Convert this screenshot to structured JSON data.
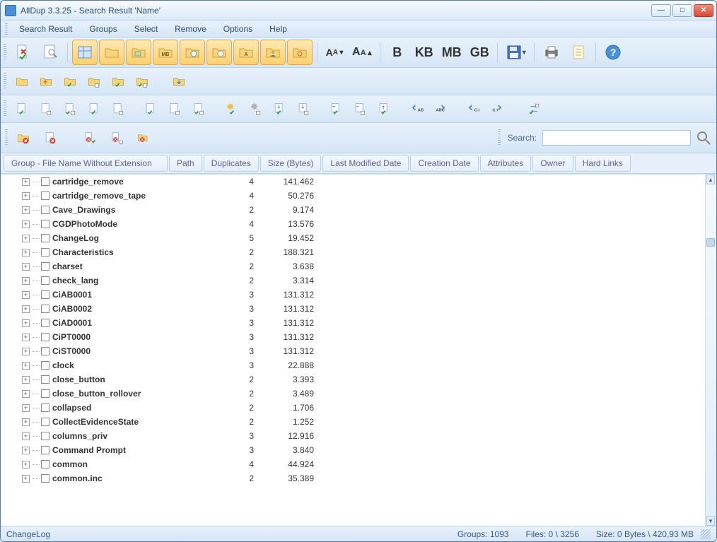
{
  "title": "AllDup 3.3.25 - Search Result 'Name'",
  "menus": [
    "Search Result",
    "Groups",
    "Select",
    "Remove",
    "Options",
    "Help"
  ],
  "font_buttons": {
    "dec": "A̲A ▾",
    "inc": "A̅A ▴"
  },
  "unit_buttons": [
    "B",
    "KB",
    "MB",
    "GB"
  ],
  "search_label": "Search:",
  "search_value": "",
  "columns": [
    "Group - File Name Without Extension",
    "Path",
    "Duplicates",
    "Size (Bytes)",
    "Last Modified Date",
    "Creation Date",
    "Attributes",
    "Owner",
    "Hard Links"
  ],
  "rows": [
    {
      "name": "cartridge_remove",
      "dup": "4",
      "size": "141.462"
    },
    {
      "name": "cartridge_remove_tape",
      "dup": "4",
      "size": "50.276"
    },
    {
      "name": "Cave_Drawings",
      "dup": "2",
      "size": "9.174"
    },
    {
      "name": "CGDPhotoMode",
      "dup": "4",
      "size": "13.576"
    },
    {
      "name": "ChangeLog",
      "dup": "5",
      "size": "19.452"
    },
    {
      "name": "Characteristics",
      "dup": "2",
      "size": "188.321"
    },
    {
      "name": "charset",
      "dup": "2",
      "size": "3.638"
    },
    {
      "name": "check_lang",
      "dup": "2",
      "size": "3.314"
    },
    {
      "name": "CiAB0001",
      "dup": "3",
      "size": "131.312"
    },
    {
      "name": "CiAB0002",
      "dup": "3",
      "size": "131.312"
    },
    {
      "name": "CiAD0001",
      "dup": "3",
      "size": "131.312"
    },
    {
      "name": "CiPT0000",
      "dup": "3",
      "size": "131.312"
    },
    {
      "name": "CiST0000",
      "dup": "3",
      "size": "131.312"
    },
    {
      "name": "clock",
      "dup": "3",
      "size": "22.888"
    },
    {
      "name": "close_button",
      "dup": "2",
      "size": "3.393"
    },
    {
      "name": "close_button_rollover",
      "dup": "2",
      "size": "3.489"
    },
    {
      "name": "collapsed",
      "dup": "2",
      "size": "1.706"
    },
    {
      "name": "CollectEvidenceState",
      "dup": "2",
      "size": "1.252"
    },
    {
      "name": "columns_priv",
      "dup": "3",
      "size": "12.916"
    },
    {
      "name": "Command Prompt",
      "dup": "3",
      "size": "3.840"
    },
    {
      "name": "common",
      "dup": "4",
      "size": "44.924"
    },
    {
      "name": "common.inc",
      "dup": "2",
      "size": "35.389"
    }
  ],
  "status_left": "ChangeLog",
  "status_groups": "Groups: 1093",
  "status_files": "Files: 0 \\ 3256",
  "status_size": "Size: 0 Bytes \\ 420,93 MB"
}
